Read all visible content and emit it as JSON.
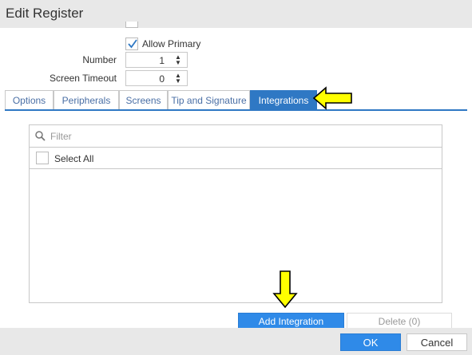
{
  "window": {
    "title": "Edit Register"
  },
  "form": {
    "allow_primary": {
      "label": "Allow Primary",
      "checked": true
    },
    "number": {
      "label": "Number",
      "value": "1"
    },
    "screen_timeout": {
      "label": "Screen Timeout",
      "value": "0"
    }
  },
  "tabs": [
    {
      "label": "Options",
      "active": false
    },
    {
      "label": "Peripherals",
      "active": false
    },
    {
      "label": "Screens",
      "active": false
    },
    {
      "label": "Tip and Signature",
      "active": false
    },
    {
      "label": "Integrations",
      "active": true
    }
  ],
  "integrations": {
    "filter_placeholder": "Filter",
    "select_all_label": "Select All"
  },
  "actions": {
    "add_label": "Add Integration",
    "delete_label": "Delete (0)"
  },
  "footer": {
    "ok_label": "OK",
    "cancel_label": "Cancel"
  },
  "colors": {
    "accent": "#2f78c4",
    "button_primary": "#2f8ae8",
    "annotation_arrow": "#ffff00"
  }
}
